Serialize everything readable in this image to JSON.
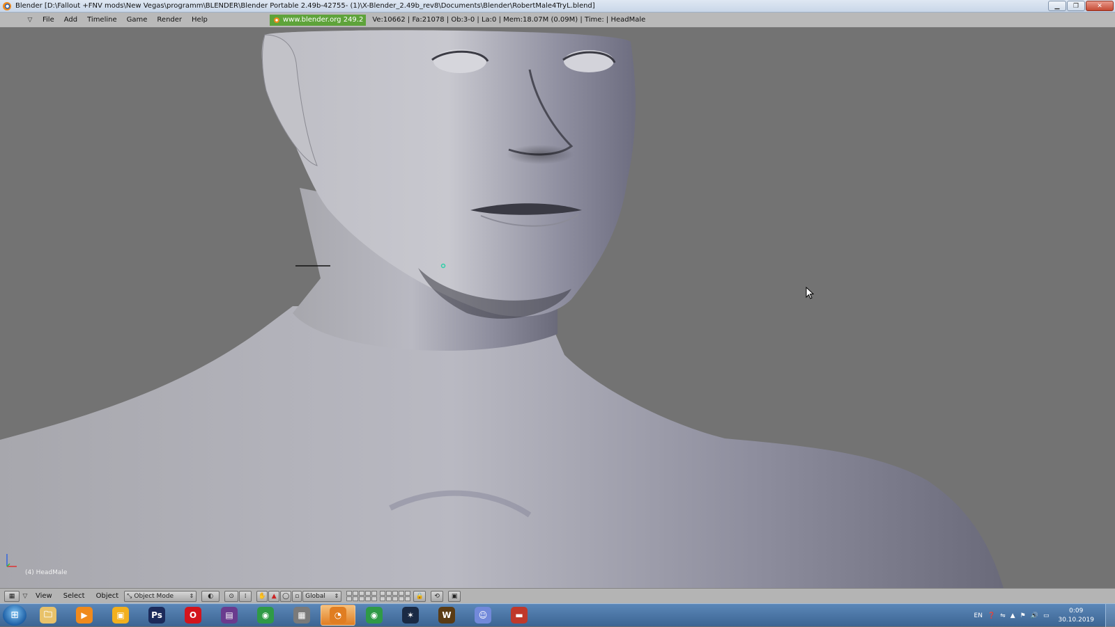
{
  "window": {
    "title": "Blender [D:\\Fallout +FNV mods\\New Vegas\\programm\\BLENDER\\Blender Portable 2.49b-42755- (1)\\X-Blender_2.49b_rev8\\Documents\\Blender\\RobertMale4TryL.blend]",
    "minimize_glyph": "▁",
    "restore_glyph": "❐",
    "close_glyph": "✕"
  },
  "info_header": {
    "menus": [
      "File",
      "Add",
      "Timeline",
      "Game",
      "Render",
      "Help"
    ],
    "blender_link": "www.blender.org 249.2",
    "stats": "Ve:10662 | Fa:21078 | Ob:3-0 | La:0  | Mem:18.07M (0.09M)  | Time: | HeadMale"
  },
  "viewport": {
    "object_label": "(4) HeadMale",
    "background_color": "#737373",
    "mesh_color": "#a9a9b8"
  },
  "view_header": {
    "menus": [
      "View",
      "Select",
      "Object"
    ],
    "mode": "Object Mode",
    "orientation": "Global"
  },
  "taskbar": {
    "apps": [
      {
        "name": "explorer-icon",
        "glyph": "🗀",
        "color": "#e8c26a"
      },
      {
        "name": "media-player-icon",
        "glyph": "▶",
        "color": "#f08a1c"
      },
      {
        "name": "files-icon",
        "glyph": "▣",
        "color": "#f2b01e"
      },
      {
        "name": "photoshop-icon",
        "glyph": "Ps",
        "color": "#1b2a5a"
      },
      {
        "name": "opera-icon",
        "glyph": "O",
        "color": "#d3141c"
      },
      {
        "name": "winrar-icon",
        "glyph": "▤",
        "color": "#6a3b8e"
      },
      {
        "name": "chrome-icon",
        "glyph": "◉",
        "color": "#2f9a46"
      },
      {
        "name": "archive-icon",
        "glyph": "▦",
        "color": "#7a7a7a"
      },
      {
        "name": "blender-icon",
        "glyph": "◔",
        "color": "#e07d21",
        "active": true
      },
      {
        "name": "chrome-alt-icon",
        "glyph": "◉",
        "color": "#2f9a46"
      },
      {
        "name": "battlenet-icon",
        "glyph": "✶",
        "color": "#1a2a44"
      },
      {
        "name": "wow-icon",
        "glyph": "W",
        "color": "#5a3b14"
      },
      {
        "name": "discord-icon",
        "glyph": "☺",
        "color": "#7289da"
      },
      {
        "name": "toolbox-icon",
        "glyph": "▬",
        "color": "#c0392b"
      }
    ],
    "tray": {
      "language": "EN",
      "time": "0:09",
      "date": "30.10.2019"
    }
  }
}
